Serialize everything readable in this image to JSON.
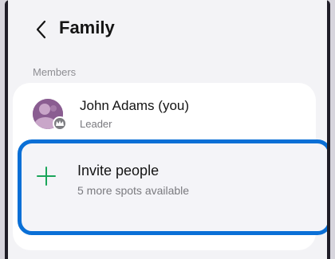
{
  "header": {
    "title": "Family"
  },
  "members_section": {
    "label": "Members"
  },
  "members": [
    {
      "name": "John Adams (you)",
      "role": "Leader",
      "avatar_icon": "person-avatar",
      "badge_icon": "crown-icon"
    }
  ],
  "invite": {
    "label": "Invite people",
    "sublabel": "5 more spots available",
    "icon": "plus-icon"
  },
  "colors": {
    "accent": "#0a6fd6",
    "plus": "#1aa55a",
    "avatar": "#8a5d91",
    "background": "#f3f3f6"
  }
}
